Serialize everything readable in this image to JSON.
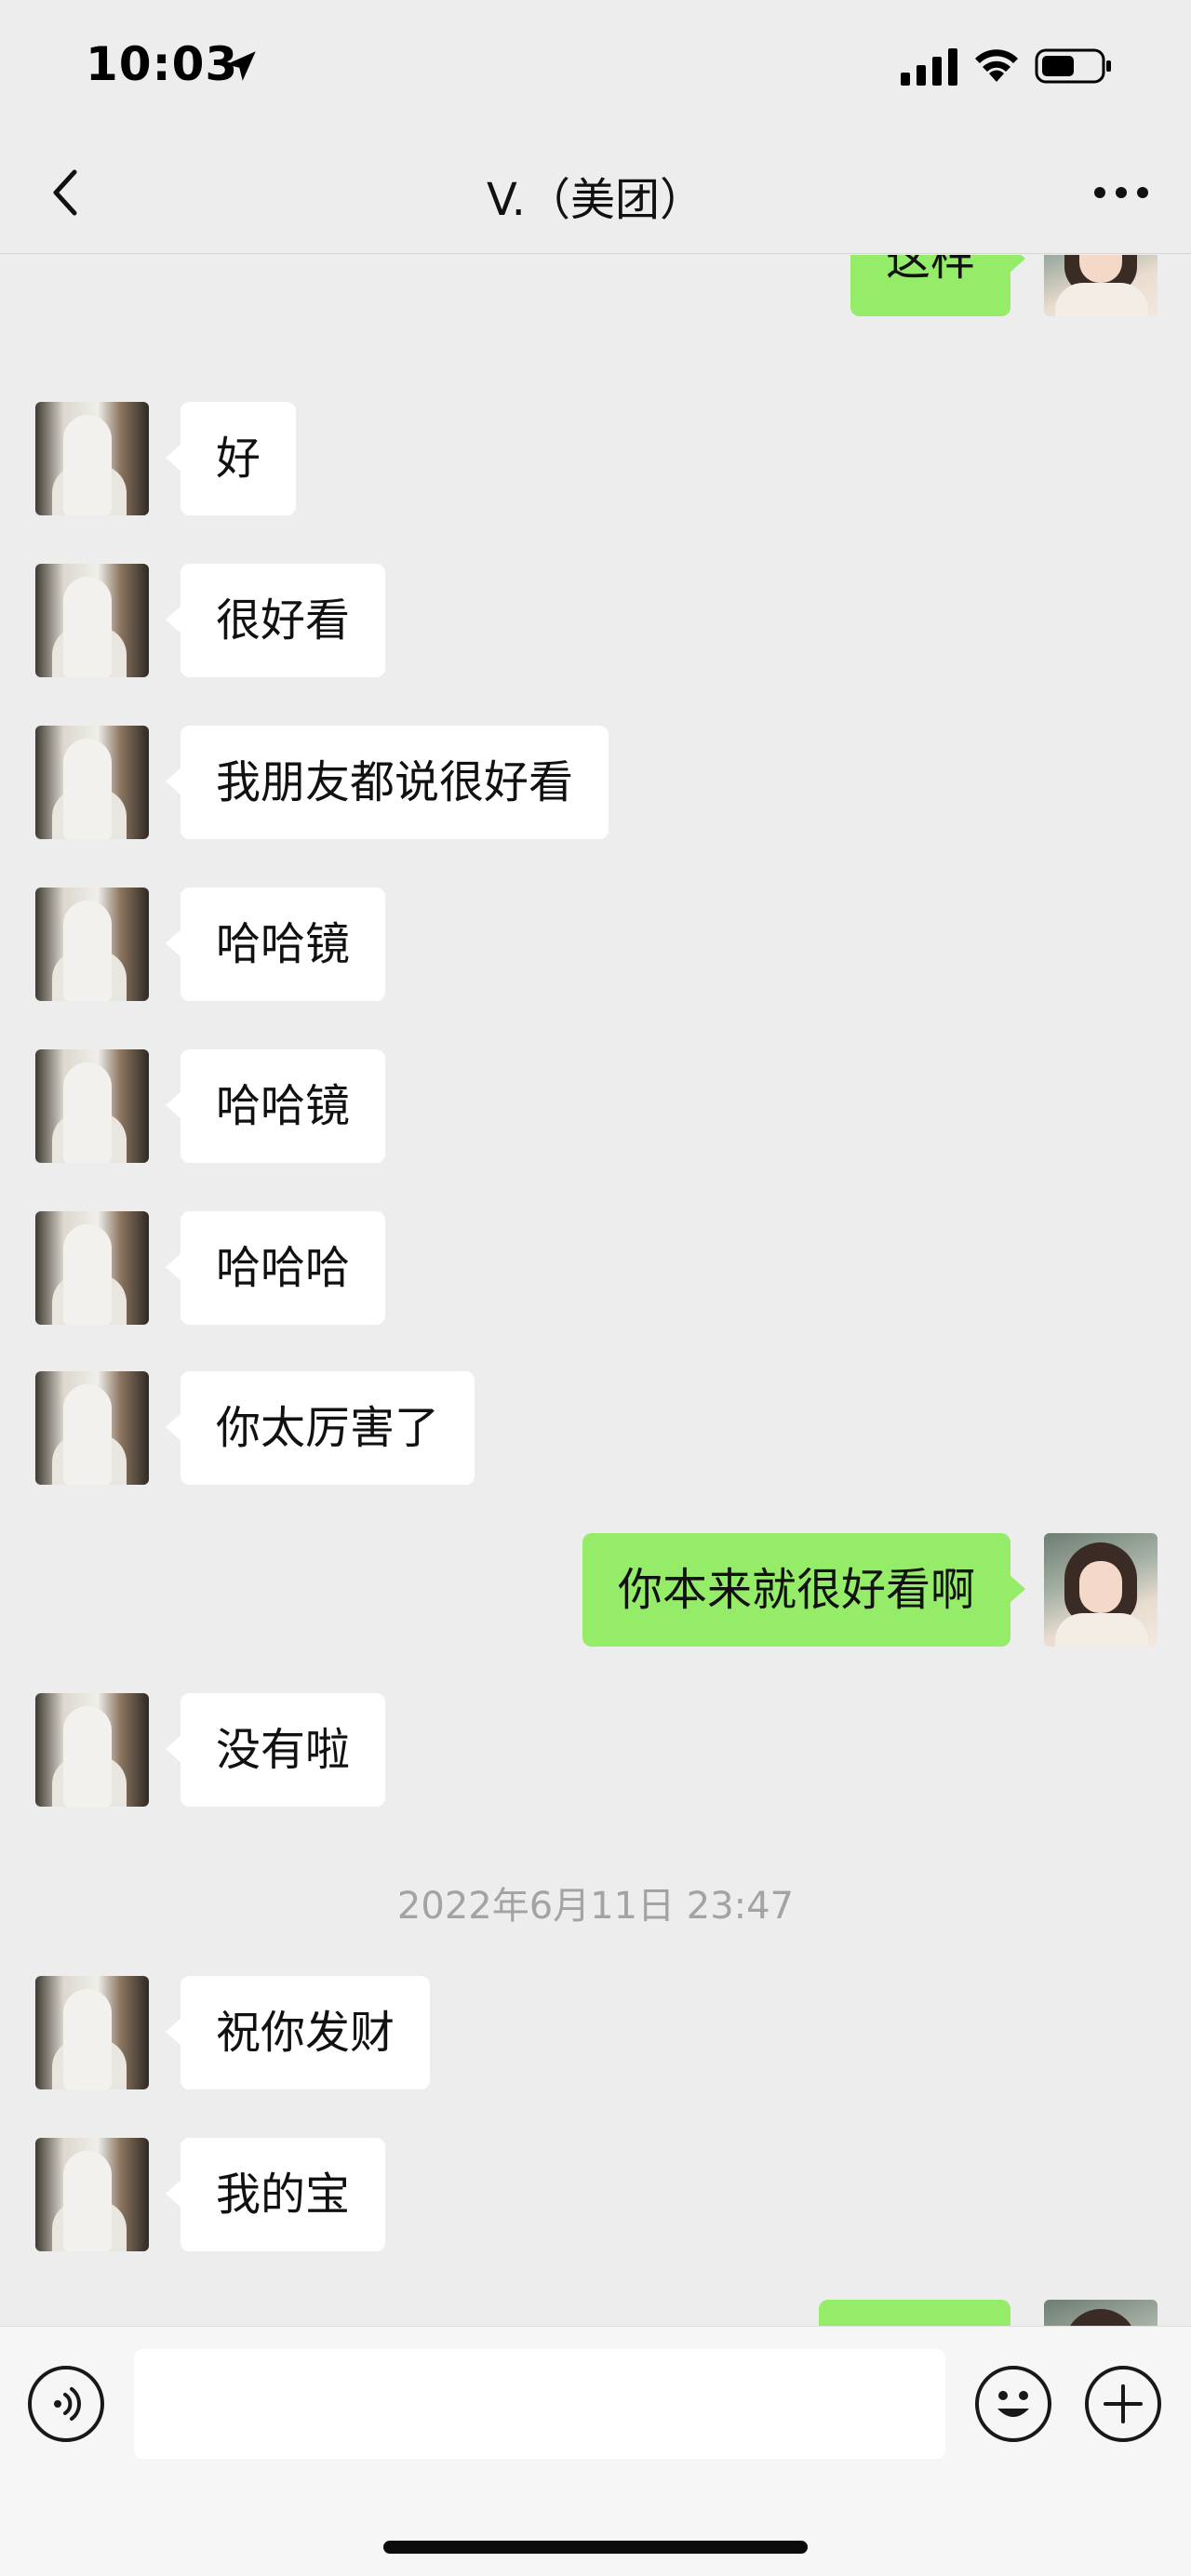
{
  "status_bar": {
    "time": "10:03",
    "icons": [
      "location-arrow-icon",
      "cellular-signal-icon",
      "wifi-icon",
      "battery-icon"
    ]
  },
  "nav": {
    "title": "V.（美团）",
    "back_icon": "chevron-left-icon",
    "more_icon": "more-dots-icon"
  },
  "messages": [
    {
      "side": "out",
      "text": "这样"
    },
    {
      "side": "in",
      "text": "好"
    },
    {
      "side": "in",
      "text": "很好看"
    },
    {
      "side": "in",
      "text": "我朋友都说很好看"
    },
    {
      "side": "in",
      "text": "哈哈镜"
    },
    {
      "side": "in",
      "text": "哈哈镜"
    },
    {
      "side": "in",
      "text": "哈哈哈"
    },
    {
      "side": "in",
      "text": "你太厉害了"
    },
    {
      "side": "out",
      "text": "你本来就很好看啊"
    },
    {
      "side": "in",
      "text": "没有啦"
    },
    {
      "side": "in",
      "text": "祝你发财"
    },
    {
      "side": "in",
      "text": "我的宝"
    },
    {
      "side": "out",
      "text": ""
    }
  ],
  "timestamp": "2022年6月11日 23:47",
  "input_bar": {
    "placeholder": "",
    "voice_icon": "voice-icon",
    "emoji_icon": "emoji-icon",
    "plus_icon": "plus-icon"
  },
  "colors": {
    "background": "#ededed",
    "outgoing_bubble": "#95ec69",
    "incoming_bubble": "#ffffff",
    "timestamp_text": "#a3a3a3"
  }
}
